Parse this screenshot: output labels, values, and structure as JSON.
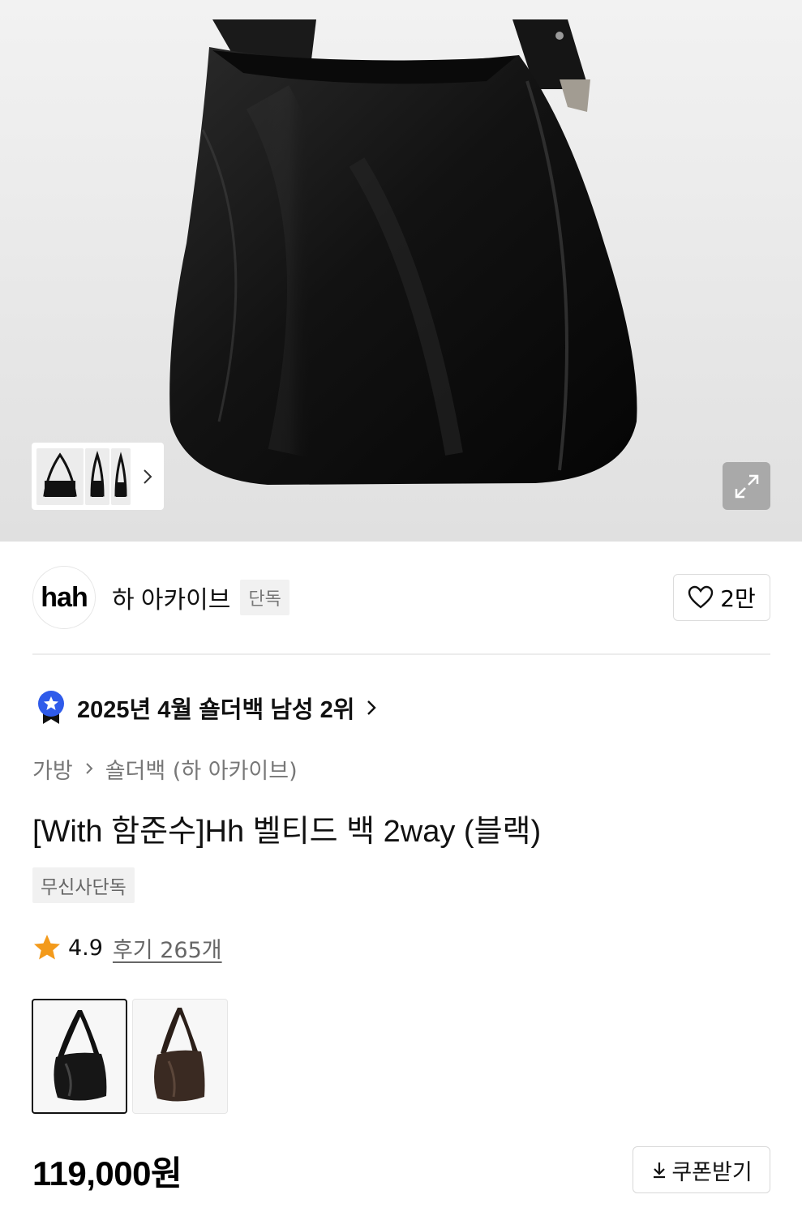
{
  "brand": {
    "logo_text": "hah",
    "name": "하 아카이브",
    "tag": "단독",
    "likes": "2만"
  },
  "ranking": {
    "text": "2025년 4월 숄더백 남성 2위",
    "badge_color": "#2f5bea"
  },
  "breadcrumb": {
    "items": [
      "가방",
      "숄더백 (하 아카이브)"
    ]
  },
  "product": {
    "title": "[With 함준수]Hh 벨티드 백 2way (블랙)",
    "exclusive_tag": "무신사단독",
    "rating": "4.9",
    "reviews": "후기 265개",
    "price": "119,000원"
  },
  "color_options": [
    "black",
    "brown"
  ],
  "actions": {
    "coupon_label": "쿠폰받기"
  },
  "icons": {
    "like": "heart-icon",
    "expand": "expand-icon",
    "coupon": "download-icon",
    "rating": "star-icon",
    "rank": "rank-badge-icon"
  },
  "colors": {
    "star": "#f39a1b",
    "rank_badge": "#2f5bea"
  }
}
